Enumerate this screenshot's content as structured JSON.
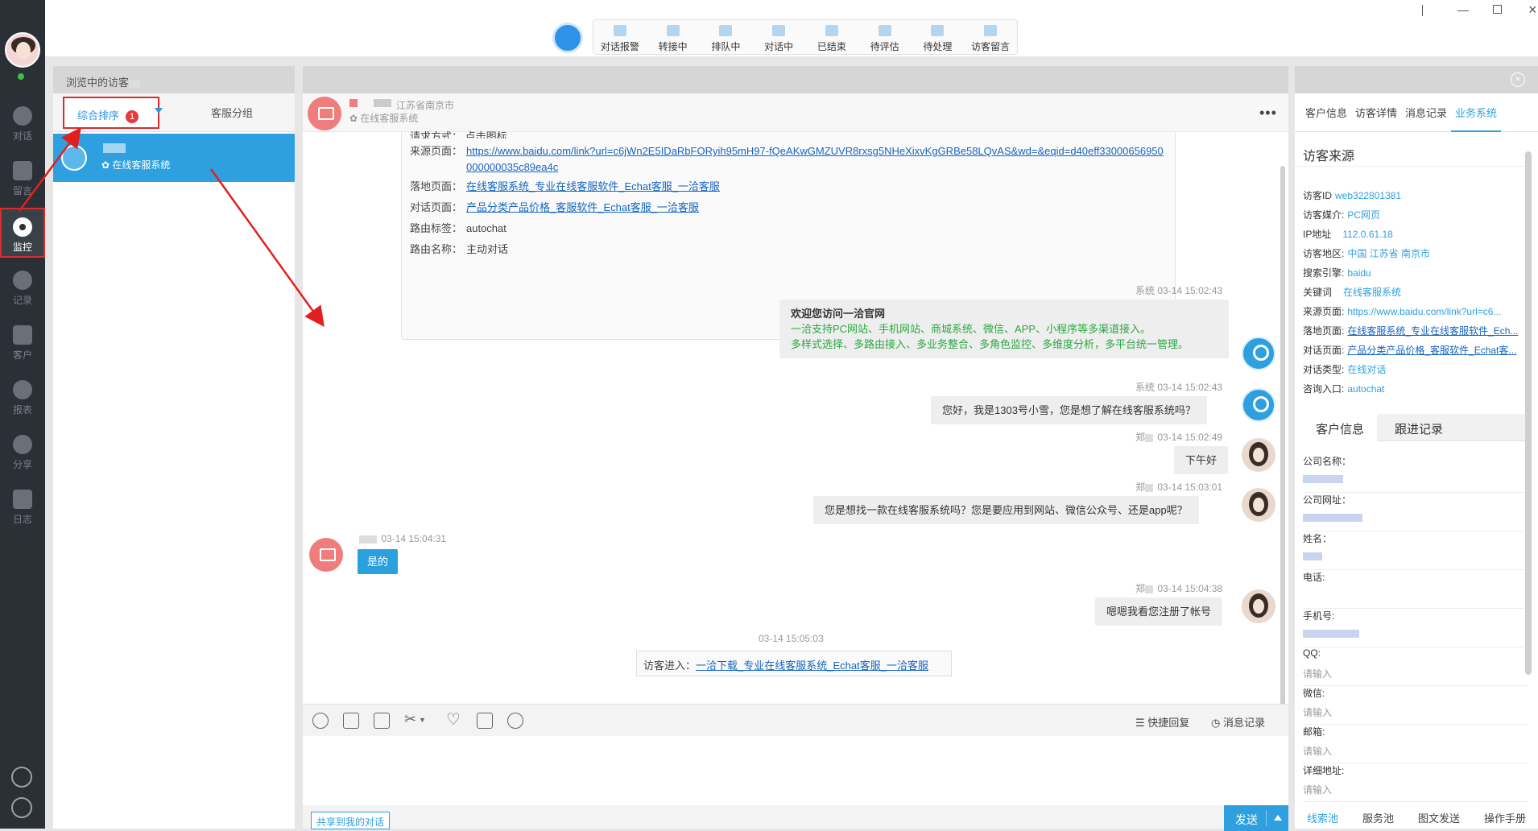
{
  "sidebar": {
    "items": [
      {
        "label": "对话"
      },
      {
        "label": "留言"
      },
      {
        "label": "监控"
      },
      {
        "label": "记录"
      },
      {
        "label": "客户"
      },
      {
        "label": "报表"
      },
      {
        "label": "分享"
      },
      {
        "label": "日志"
      }
    ]
  },
  "topbar": {
    "tools": [
      "对话报警",
      "转接中",
      "排队中",
      "对话中",
      "已结束",
      "待评估",
      "待处理",
      "访客留言"
    ]
  },
  "left": {
    "header": "浏览中的访客",
    "tab_sort": "综合排序",
    "badge": "1",
    "tab_group": "客服分组",
    "visitor_sys": "在线客服系统"
  },
  "chat": {
    "location": "江苏省南京市",
    "system": "在线客服系统",
    "info": {
      "partial_row": "请求方式： 点击图标",
      "source_label": "来源页面：",
      "source_url": "https://www.baidu.com/link?url=c6jWn2E5IDaRbFORyih95mH97-fQeAKwGMZUVR8rxsg5NHeXixvKgGRBe58LQvAS&wd=&eqid=d40eff33000656950000000035c89ea4c",
      "landing_label": "落地页面：",
      "landing": "在线客服系统_专业在线客服软件_Echat客服_一洽客服",
      "dialog_label": "对话页面：",
      "dialog": "产品分类产品价格_客服软件_Echat客服_一洽客服",
      "route_tag_label": "路由标签：",
      "route_tag": "autochat",
      "route_name_label": "路由名称：",
      "route_name": "主动对话"
    },
    "messages": [
      {
        "who": "系统",
        "time": "03-14 15:02:43",
        "title": "欢迎您访问一洽官网",
        "line1": "一洽支持PC网站、手机网站、商城系统、微信、APP、小程序等多渠道接入。",
        "line2": "多样式选择、多路由接入、多业务整合、多角色监控、多维度分析，多平台统一管理。"
      },
      {
        "who": "系统",
        "time": "03-14 15:02:43",
        "text": "您好，我是1303号小雪，您是想了解在线客服系统吗？"
      },
      {
        "who": "郑",
        "time": "03-14 15:02:49",
        "text": "下午好"
      },
      {
        "who": "郑",
        "time": "03-14 15:03:01",
        "text": "您是想找一款在线客服系统吗？您是要应用到网站、微信公众号、还是app呢？"
      },
      {
        "who": "",
        "time": "03-14 15:04:31",
        "text": "是的"
      },
      {
        "who": "郑",
        "time": "03-14 15:04:38",
        "text": "嗯嗯我看您注册了帐号"
      }
    ],
    "enter_time": "03-14 15:05:03",
    "enter_label": "访客进入：",
    "enter_link": "一洽下载_专业在线客服系统_Echat客服_一洽客服",
    "quick_reply": "快捷回复",
    "history": "消息记录",
    "share": "共享到我的对话",
    "send": "发送"
  },
  "right": {
    "tabs": [
      "客户信息",
      "访客详情",
      "消息记录",
      "业务系统"
    ],
    "section": "访客来源",
    "rows": [
      {
        "k": "访客ID",
        "v": "web322801381"
      },
      {
        "k": "访客媒介:",
        "v": "PC网页"
      },
      {
        "k": "IP地址",
        "v": "112.0.61.18"
      },
      {
        "k": "访客地区:",
        "v": "中国 江苏省 南京市"
      },
      {
        "k": "搜索引擎:",
        "v": "baidu"
      },
      {
        "k": "关键词",
        "v": "在线客服系统"
      },
      {
        "k": "来源页面:",
        "v": "https://www.baidu.com/link?url=c6..."
      },
      {
        "k": "落地页面:",
        "v": "在线客服系统_专业在线客服软件_Ech..."
      },
      {
        "k": "对话页面:",
        "v": "产品分类产品价格_客服软件_Echat客..."
      },
      {
        "k": "对话类型:",
        "v": "在线对话"
      },
      {
        "k": "咨询入口:",
        "v": "autochat"
      }
    ],
    "tabs2": [
      "客户信息",
      "跟进记录"
    ],
    "fields": [
      {
        "k": "公司名称：",
        "v": ""
      },
      {
        "k": "公司网址：",
        "v": ""
      },
      {
        "k": "姓名：",
        "v": ""
      },
      {
        "k": "电话:",
        "v": ""
      },
      {
        "k": "手机号:",
        "v": ""
      },
      {
        "k": "QQ:",
        "v": "请输入"
      },
      {
        "k": "微信:",
        "v": "请输入"
      },
      {
        "k": "邮箱:",
        "v": "请输入"
      },
      {
        "k": "详细地址:",
        "v": "请输入"
      }
    ],
    "bottom": [
      "线索池",
      "服务池",
      "图文发送",
      "操作手册"
    ]
  },
  "colors": {
    "accent": "#2ea0df",
    "highlight": "#d62e2e",
    "sidebar": "#2b3036"
  }
}
